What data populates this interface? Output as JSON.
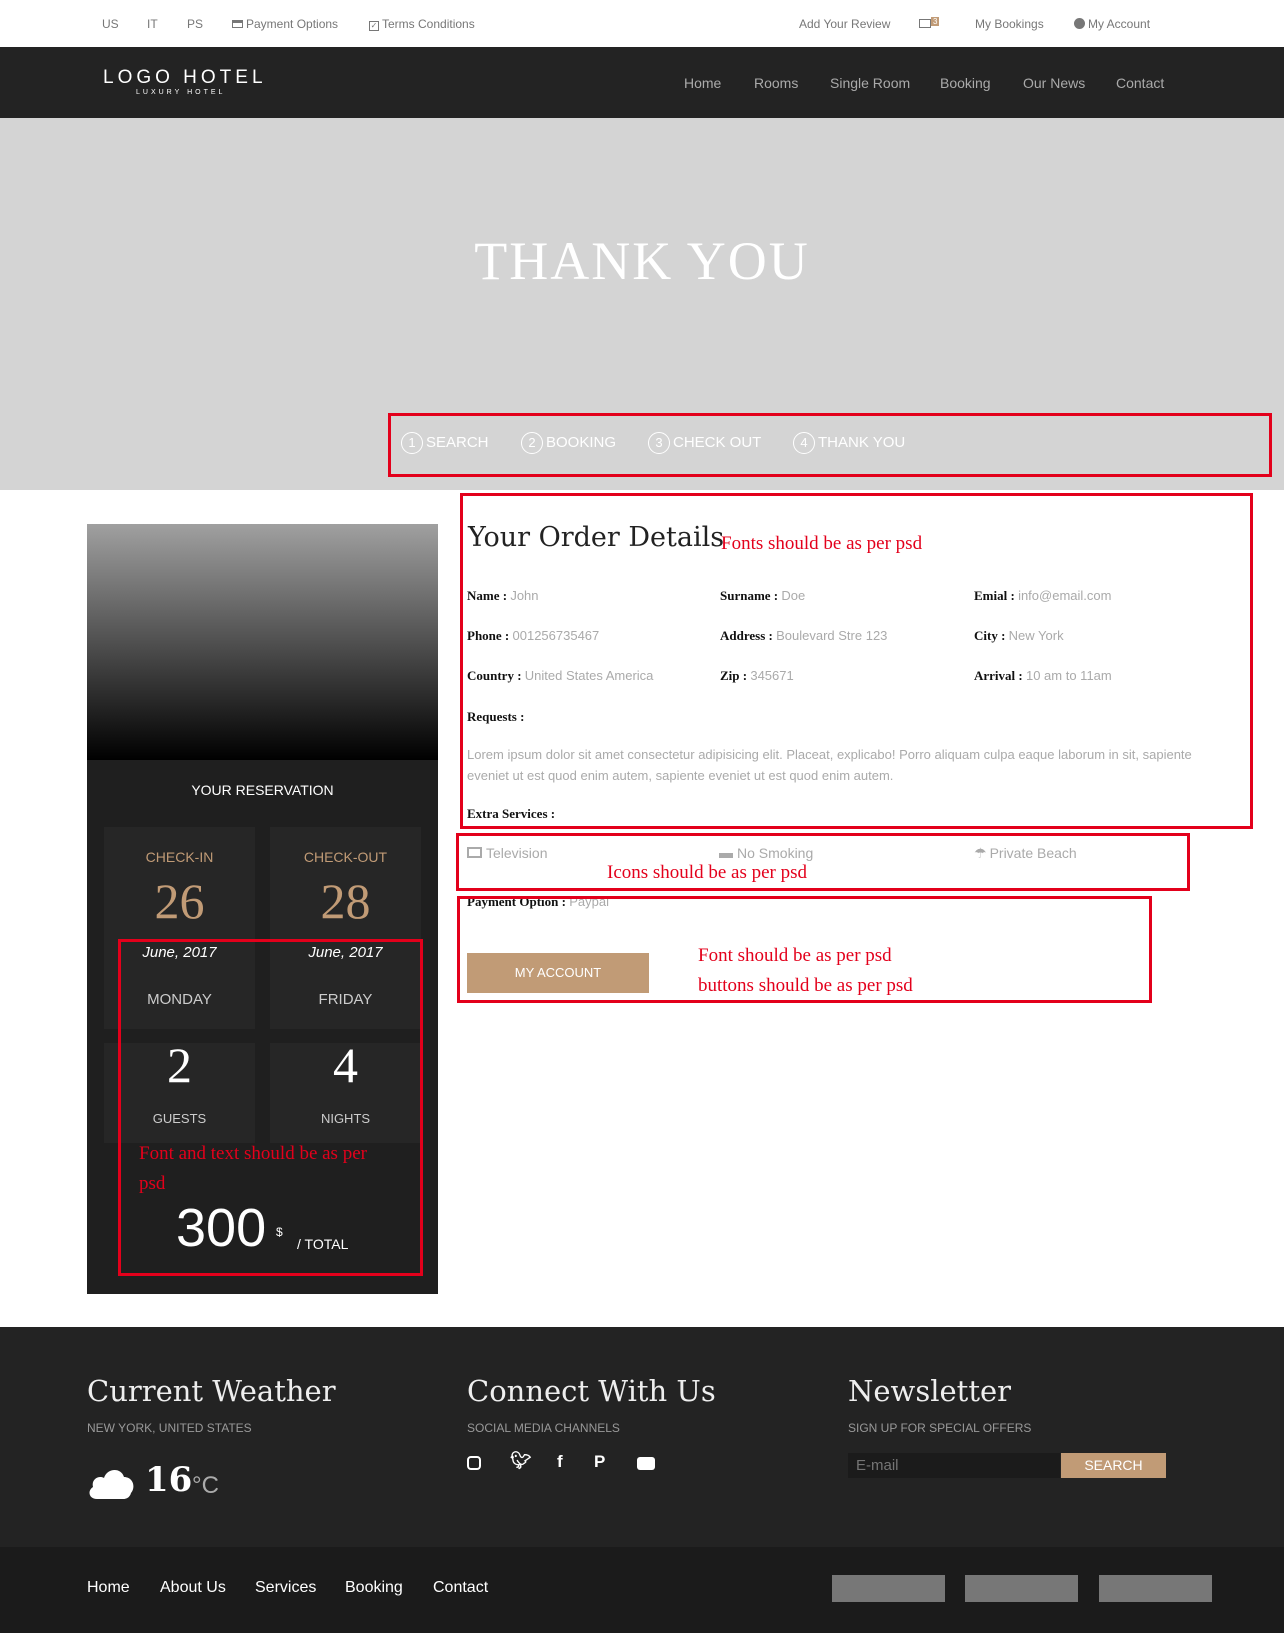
{
  "topbar": {
    "lang_us": "US",
    "lang_it": "IT",
    "lang_ps": "PS",
    "payment": "Payment Options",
    "terms": "Terms Conditions",
    "review": "Add Your Review",
    "mail_count": "3",
    "bookings": "My Bookings",
    "account": "My Account"
  },
  "logo": {
    "title": "LOGO HOTEL",
    "subtitle": "LUXURY HOTEL"
  },
  "nav": [
    "Home",
    "Rooms",
    "Single Room",
    "Booking",
    "Our News",
    "Contact"
  ],
  "hero": {
    "title": "THANK YOU"
  },
  "steps": [
    {
      "n": "1",
      "label": "SEARCH"
    },
    {
      "n": "2",
      "label": "BOOKING"
    },
    {
      "n": "3",
      "label": "CHECK OUT"
    },
    {
      "n": "4",
      "label": "THANK YOU"
    }
  ],
  "reservation": {
    "title": "YOUR RESERVATION",
    "checkin_label": "CHECK-IN",
    "checkin_day": "26",
    "checkin_month": "June, 2017",
    "checkin_weekday": "MONDAY",
    "checkout_label": "CHECK-OUT",
    "checkout_day": "28",
    "checkout_month": "June, 2017",
    "checkout_weekday": "FRIDAY",
    "guests": "2",
    "guests_label": "GUESTS",
    "nights": "4",
    "nights_label": "NIGHTS",
    "total": "300",
    "currency": "$",
    "total_label": "/ TOTAL"
  },
  "order": {
    "title": "Your Order Details",
    "name_label": "Name :",
    "name": "John",
    "surname_label": "Surname :",
    "surname": "Doe",
    "email_label": "Emial :",
    "email": "info@email.com",
    "phone_label": "Phone :",
    "phone": "001256735467",
    "address_label": "Address :",
    "address": "Boulevard Stre 123",
    "city_label": "City :",
    "city": "New York",
    "country_label": "Country :",
    "country": "United States America",
    "zip_label": "Zip :",
    "zip": "345671",
    "arrival_label": "Arrival :",
    "arrival": "10 am to 11am",
    "requests_label": "Requests :",
    "requests": "Lorem ipsum dolor sit amet consectetur adipisicing elit. Placeat, explicabo! Porro aliquam culpa eaque laborum in sit, sapiente eveniet ut est quod enim autem, sapiente eveniet ut est quod enim autem.",
    "extra_label": "Extra Services :",
    "services": [
      "Television",
      "No Smoking",
      "Private Beach"
    ],
    "payment_label": "Payment Option :",
    "payment": "Paypal",
    "account_button": "MY ACCOUNT"
  },
  "notes": {
    "fonts": "Fonts should be as per psd",
    "icons": "Icons should be as per psd",
    "font1": "Font should be as per psd",
    "buttons": "buttons should be as per psd",
    "restext1": "Font and text should be as per",
    "restext2": "psd"
  },
  "footer": {
    "weather_title": "Current Weather",
    "weather_sub": "NEW YORK, UNITED STATES",
    "temp": "16",
    "unit": "°C",
    "connect_title": "Connect With Us",
    "connect_sub": "SOCIAL MEDIA CHANNELS",
    "news_title": "Newsletter",
    "news_sub": "SIGN UP FOR SPECIAL OFFERS",
    "email_placeholder": "E-mail",
    "search_button": "SEARCH",
    "links": [
      "Home",
      "About Us",
      "Services",
      "Booking",
      "Contact"
    ]
  },
  "colors": {
    "accent": "#c19b76",
    "dark": "#232323",
    "highlight": "#e3001b"
  }
}
